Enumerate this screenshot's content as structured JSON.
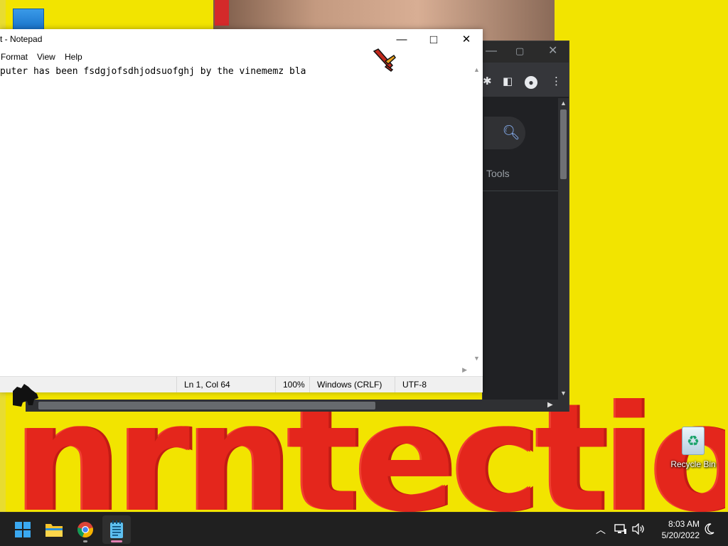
{
  "wallpaper": {
    "big_word": "nrntectionn"
  },
  "desktop": {
    "recycle_bin_label": "Recycle Bin"
  },
  "chrome": {
    "tools_label": "Tools",
    "minimize_glyph": "—",
    "maximize_glyph": "▢",
    "close_glyph": "✕"
  },
  "notepad": {
    "title": "t - Notepad",
    "menus": [
      "Format",
      "View",
      "Help"
    ],
    "content": "puter has been fsdgjofsdhjodsuofghj by the vinememz bla",
    "status": {
      "position": "Ln 1, Col 64",
      "zoom": "100%",
      "line_ending": "Windows (CRLF)",
      "encoding": "UTF-8"
    },
    "minimize_glyph": "—",
    "maximize_glyph": "□",
    "close_glyph": "✕"
  },
  "taskbar": {
    "apps": [
      "start",
      "file-explorer",
      "chrome",
      "notepad"
    ],
    "active_app": "notepad",
    "clock": {
      "time": "8:03 AM",
      "date": "5/20/2022"
    }
  },
  "colors": {
    "wallpaper_yellow": "#f2e400",
    "wallpaper_red": "#e4261c",
    "taskbar": "#202020",
    "chrome_dark": "#202124"
  }
}
